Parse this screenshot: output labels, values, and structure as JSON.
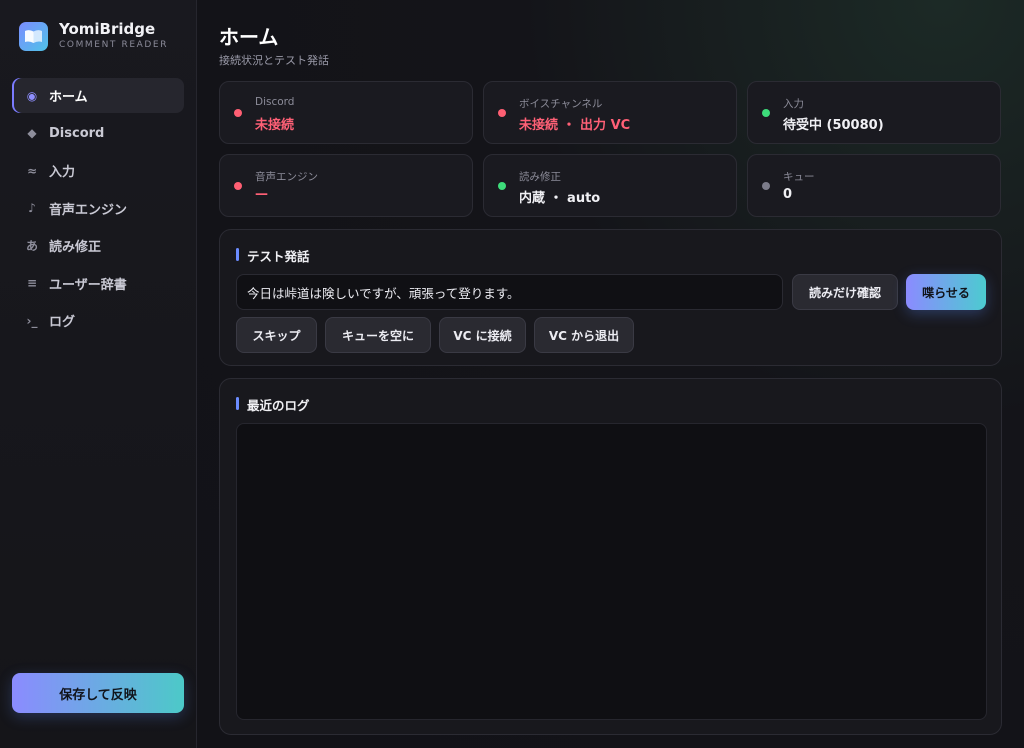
{
  "brand": {
    "name": "YomiBridge",
    "subtitle": "COMMENT READER"
  },
  "nav": [
    {
      "label": "ホーム",
      "icon": "◉"
    },
    {
      "label": "Discord",
      "icon": "◆"
    },
    {
      "label": "入力",
      "icon": "≈"
    },
    {
      "label": "音声エンジン",
      "icon": "♪"
    },
    {
      "label": "読み修正",
      "icon": "あ"
    },
    {
      "label": "ユーザー辞書",
      "icon": "≡"
    },
    {
      "label": "ログ",
      "icon": "›_"
    }
  ],
  "save_button": "保存して反映",
  "page": {
    "title": "ホーム",
    "subtitle": "接続状況とテスト発話"
  },
  "status_cards": [
    {
      "label": "Discord",
      "value": "未接続",
      "status": "red"
    },
    {
      "label": "ボイスチャンネル",
      "value": "未接続 ・ 出力 VC",
      "status": "red"
    },
    {
      "label": "入力",
      "value": "待受中 (50080)",
      "status": "green"
    },
    {
      "label": "音声エンジン",
      "value": "—",
      "status": "red"
    },
    {
      "label": "読み修正",
      "value": "内蔵 ・ auto",
      "status": "green"
    },
    {
      "label": "キュー",
      "value": "0",
      "status": "gray"
    }
  ],
  "test_panel": {
    "title": "テスト発話",
    "input_value": "今日は峠道は険しいですが、頑張って登ります。",
    "preview_button": "読みだけ確認",
    "speak_button": "喋らせる",
    "skip_button": "スキップ",
    "clear_queue_button": "キューを空に",
    "vc_connect_button": "VC に接続",
    "vc_leave_button": "VC から退出"
  },
  "log_panel": {
    "title": "最近のログ"
  },
  "colors": {
    "accent": "#8b8bff",
    "accent2": "#4cc9c8",
    "error": "#ff5f73",
    "ok": "#3ddc7a"
  }
}
